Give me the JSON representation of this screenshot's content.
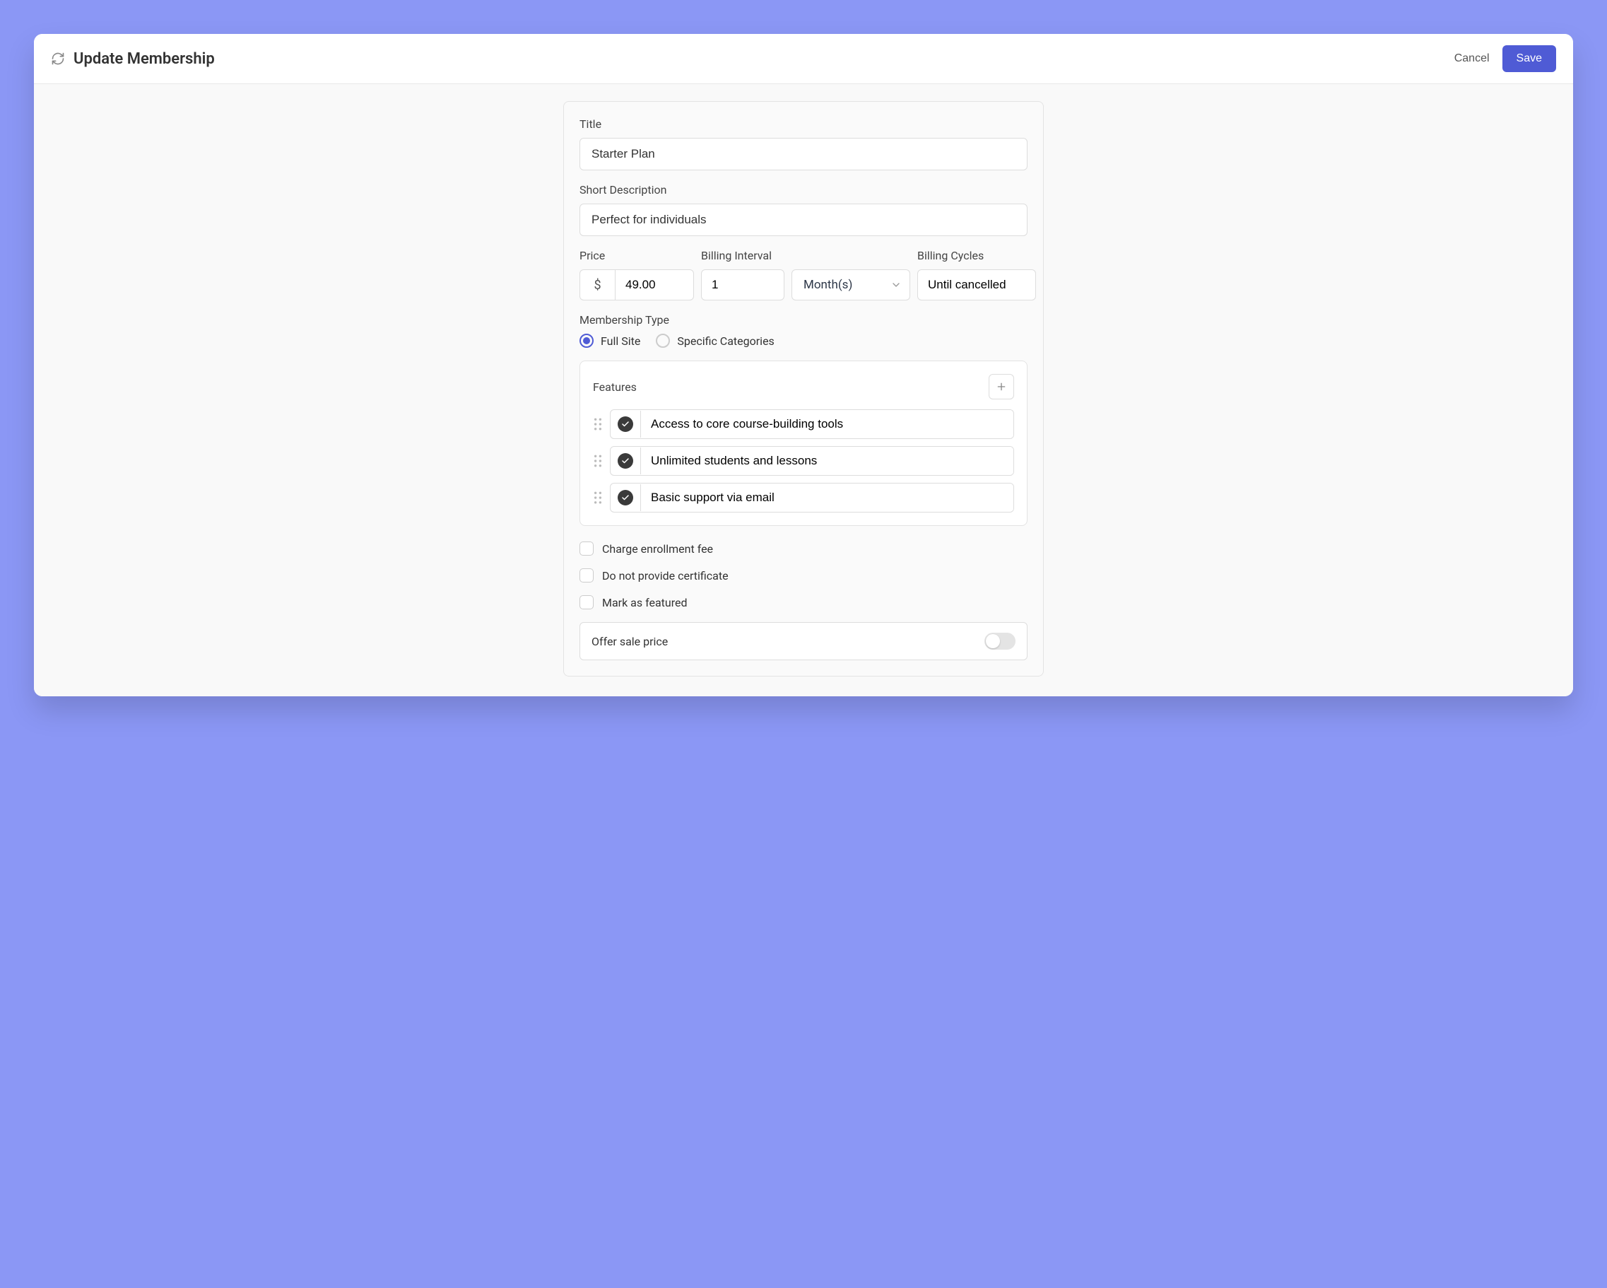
{
  "header": {
    "title": "Update Membership",
    "cancel_label": "Cancel",
    "save_label": "Save"
  },
  "form": {
    "title_label": "Title",
    "title_value": "Starter Plan",
    "short_desc_label": "Short Description",
    "short_desc_value": "Perfect for individuals",
    "price_label": "Price",
    "price_prefix": "$",
    "price_value": "49.00",
    "billing_interval_label": "Billing Interval",
    "billing_interval_value": "1",
    "billing_interval_unit": "Month(s)",
    "billing_cycles_label": "Billing Cycles",
    "billing_cycles_value": "Until cancelled",
    "membership_type_label": "Membership Type",
    "membership_type_options": {
      "full_site": "Full Site",
      "specific": "Specific Categories"
    },
    "membership_type_selected": "full_site",
    "features_label": "Features",
    "features": [
      "Access to core course-building tools",
      "Unlimited students and lessons",
      "Basic support via email"
    ],
    "checkboxes": {
      "enrollment_fee": "Charge enrollment fee",
      "no_certificate": "Do not provide certificate",
      "mark_featured": "Mark as featured"
    },
    "toggle": {
      "offer_sale_label": "Offer sale price",
      "offer_sale_on": false
    }
  }
}
